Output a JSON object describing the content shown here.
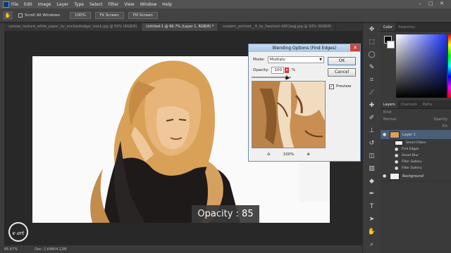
{
  "menubar": {
    "items": [
      "File",
      "Edit",
      "Image",
      "Layer",
      "Type",
      "Select",
      "Filter",
      "View",
      "Window",
      "Help"
    ],
    "window_controls": [
      "–",
      "□",
      "✕"
    ]
  },
  "options_bar": {
    "scroll_all_label": "Scroll All Windows",
    "zoom_value": "100%",
    "fit_screen": "Fit Screen",
    "fill_screen": "Fill Screen"
  },
  "tabs": [
    {
      "label": "canvas_texture_white_paper_by_enchantedgal_stock.jpg @ 50% (RGB/8)",
      "active": false
    },
    {
      "label": "Untitled-1 @ 66.7% (Layer 1, RGB/8) *",
      "active": true
    },
    {
      "label": "modern_portrait__9_by_faestock-d951wgj.jpg @ 50% (RGB/8)",
      "active": false
    }
  ],
  "status": {
    "zoom": "66.67%",
    "doc": "Doc: 2.64M/4.12M"
  },
  "dialog": {
    "title": "Blending Options (Find Edges)",
    "mode_label": "Mode:",
    "mode_value": "Multiply",
    "opacity_label": "Opacity:",
    "opacity_value": "100",
    "opacity_unit": "%",
    "ok": "OK",
    "cancel": "Cancel",
    "preview_label": "Preview",
    "preview_checked": true,
    "zoom": "100%"
  },
  "caption": "Opacity : 85",
  "watermark": "e art",
  "panels": {
    "color_tabs": [
      "Color",
      "Swatches"
    ],
    "layer_tabs": [
      "Layers",
      "Channels",
      "Paths"
    ],
    "layers_search": "Kind",
    "blend_mode": "Normal",
    "opacity_label": "Opacity:",
    "fill_label": "Fill:",
    "layer1": "Layer 1",
    "smart_filters": "Smart Filters",
    "filters": [
      "Find Edges",
      "Smart Blur",
      "Filter Gallery",
      "Filter Gallery"
    ],
    "background": "Background"
  },
  "colors": {
    "accent": "#31a8ff",
    "selected_layer": "#4a5e78"
  }
}
